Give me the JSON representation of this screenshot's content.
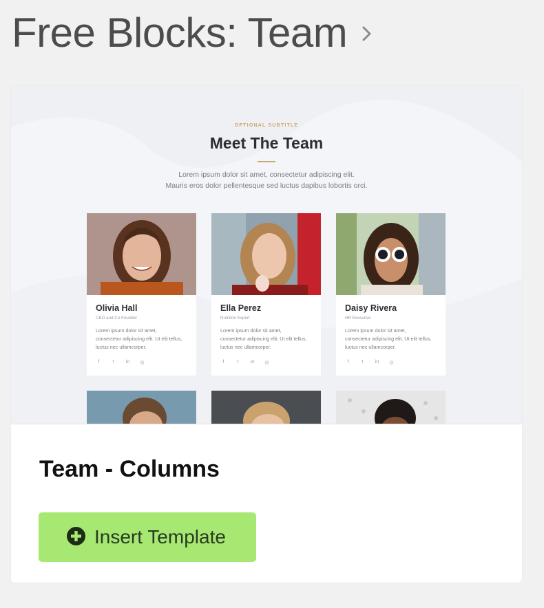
{
  "header": {
    "title": "Free Blocks: Team",
    "chevron_icon": "chevron-right-icon"
  },
  "preview": {
    "subtitle": "OPTIONAL SUBTITLE",
    "title": "Meet The Team",
    "intro_line1": "Lorem ipsum dolor sit amet, consectetur adipiscing elit.",
    "intro_line2": "Mauris eros dolor pellentesque sed luctus dapibus lobortis orci.",
    "members": [
      {
        "name": "Olivia Hall",
        "role": "CEO and Co-Founder",
        "bio_line1": "Lorem ipsum dolor sit amet,",
        "bio_line2": "consectetur adipiscing elit. Ut elit tellus,",
        "bio_line3": "luctus nec ullamcorper."
      },
      {
        "name": "Ella Perez",
        "role": "Nutrition Expert",
        "bio_line1": "Lorem ipsum dolor sit amet,",
        "bio_line2": "consectetur adipiscing elit. Ut elit tellus,",
        "bio_line3": "luctus nec ullamcorper."
      },
      {
        "name": "Daisy Rivera",
        "role": "HR Executive",
        "bio_line1": "Lorem ipsum dolor sit amet,",
        "bio_line2": "consectetur adipiscing elit. Ut elit tellus,",
        "bio_line3": "luctus nec ullamcorper."
      }
    ],
    "social_icons": {
      "facebook": "f",
      "twitter": "t",
      "linkedin": "in",
      "instagram": "◎"
    }
  },
  "card": {
    "template_name": "Team - Columns",
    "insert_button": {
      "label": "Insert Template",
      "icon": "plus-circle-icon"
    }
  },
  "colors": {
    "accent_green": "#a6e871",
    "gold": "#c9a66b",
    "heading": "#2d2d35"
  }
}
